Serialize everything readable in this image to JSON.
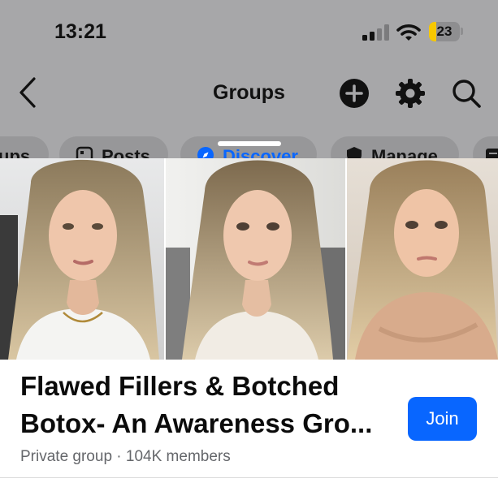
{
  "status_bar": {
    "time": "13:21",
    "battery": "23",
    "battery_level": 0.23
  },
  "nav": {
    "title": "Groups",
    "icons": [
      "back-chevron-icon",
      "add-circle-icon",
      "gear-icon",
      "search-icon"
    ]
  },
  "tabs": [
    {
      "label": "ups",
      "icon": ""
    },
    {
      "label": "Posts",
      "icon": "posts-icon"
    },
    {
      "label": "Discover",
      "icon": "compass-icon",
      "selected": true
    },
    {
      "label": "Manage",
      "icon": "shield-icon"
    },
    {
      "label": "",
      "icon": "feed-icon"
    }
  ],
  "group": {
    "name_line1": "Flawed Fillers & Botched",
    "name_line2": "Botox- An Awareness Gro...",
    "meta": "Private group · 104K members",
    "join_label": "Join",
    "photos": [
      "photo-1",
      "photo-2",
      "photo-3"
    ]
  },
  "colors": {
    "accent": "#0866ff",
    "overlay": "#a7a7a9",
    "text_secondary": "#65676b"
  }
}
